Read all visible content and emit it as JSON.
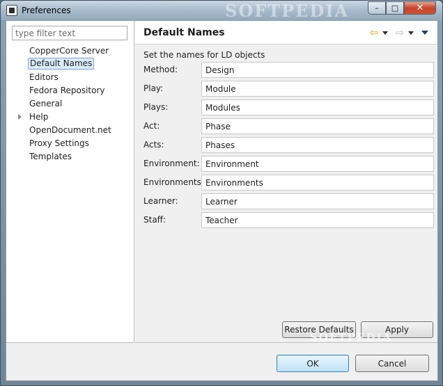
{
  "window": {
    "title": "Preferences",
    "watermark": "SOFTPEDIA",
    "minimize_glyph": "–",
    "maximize_glyph": "□",
    "close_glyph": "✕"
  },
  "filter": {
    "placeholder": "type filter text",
    "value": ""
  },
  "tree": [
    {
      "label": "CopperCore Server",
      "selected": false,
      "expandable": false
    },
    {
      "label": "Default Names",
      "selected": true,
      "expandable": false
    },
    {
      "label": "Editors",
      "selected": false,
      "expandable": false
    },
    {
      "label": "Fedora Repository",
      "selected": false,
      "expandable": false
    },
    {
      "label": "General",
      "selected": false,
      "expandable": false
    },
    {
      "label": "Help",
      "selected": false,
      "expandable": true
    },
    {
      "label": "OpenDocument.net",
      "selected": false,
      "expandable": false
    },
    {
      "label": "Proxy Settings",
      "selected": false,
      "expandable": false
    },
    {
      "label": "Templates",
      "selected": false,
      "expandable": false
    }
  ],
  "page": {
    "title": "Default Names",
    "intro": "Set the names for LD objects",
    "nav": {
      "back_glyph": "⇦",
      "forward_glyph": "⇨"
    },
    "fields": [
      {
        "label": "Method:",
        "value": "Design"
      },
      {
        "label": "Play:",
        "value": "Module"
      },
      {
        "label": "Plays:",
        "value": "Modules"
      },
      {
        "label": "Act:",
        "value": "Phase"
      },
      {
        "label": "Acts:",
        "value": "Phases"
      },
      {
        "label": "Environment:",
        "value": "Environment"
      },
      {
        "label": "Environments:",
        "value": "Environments"
      },
      {
        "label": "Learner:",
        "value": "Learner"
      },
      {
        "label": "Staff:",
        "value": "Teacher"
      }
    ],
    "restore_label": "Restore Defaults",
    "apply_label": "Apply"
  },
  "dialog": {
    "ok_label": "OK",
    "cancel_label": "Cancel"
  },
  "colors": {
    "selection_fill": "#dcecfc",
    "selection_border": "#7da2ce",
    "close_button": "#c7432a",
    "back_arrow": "#e0a000"
  }
}
